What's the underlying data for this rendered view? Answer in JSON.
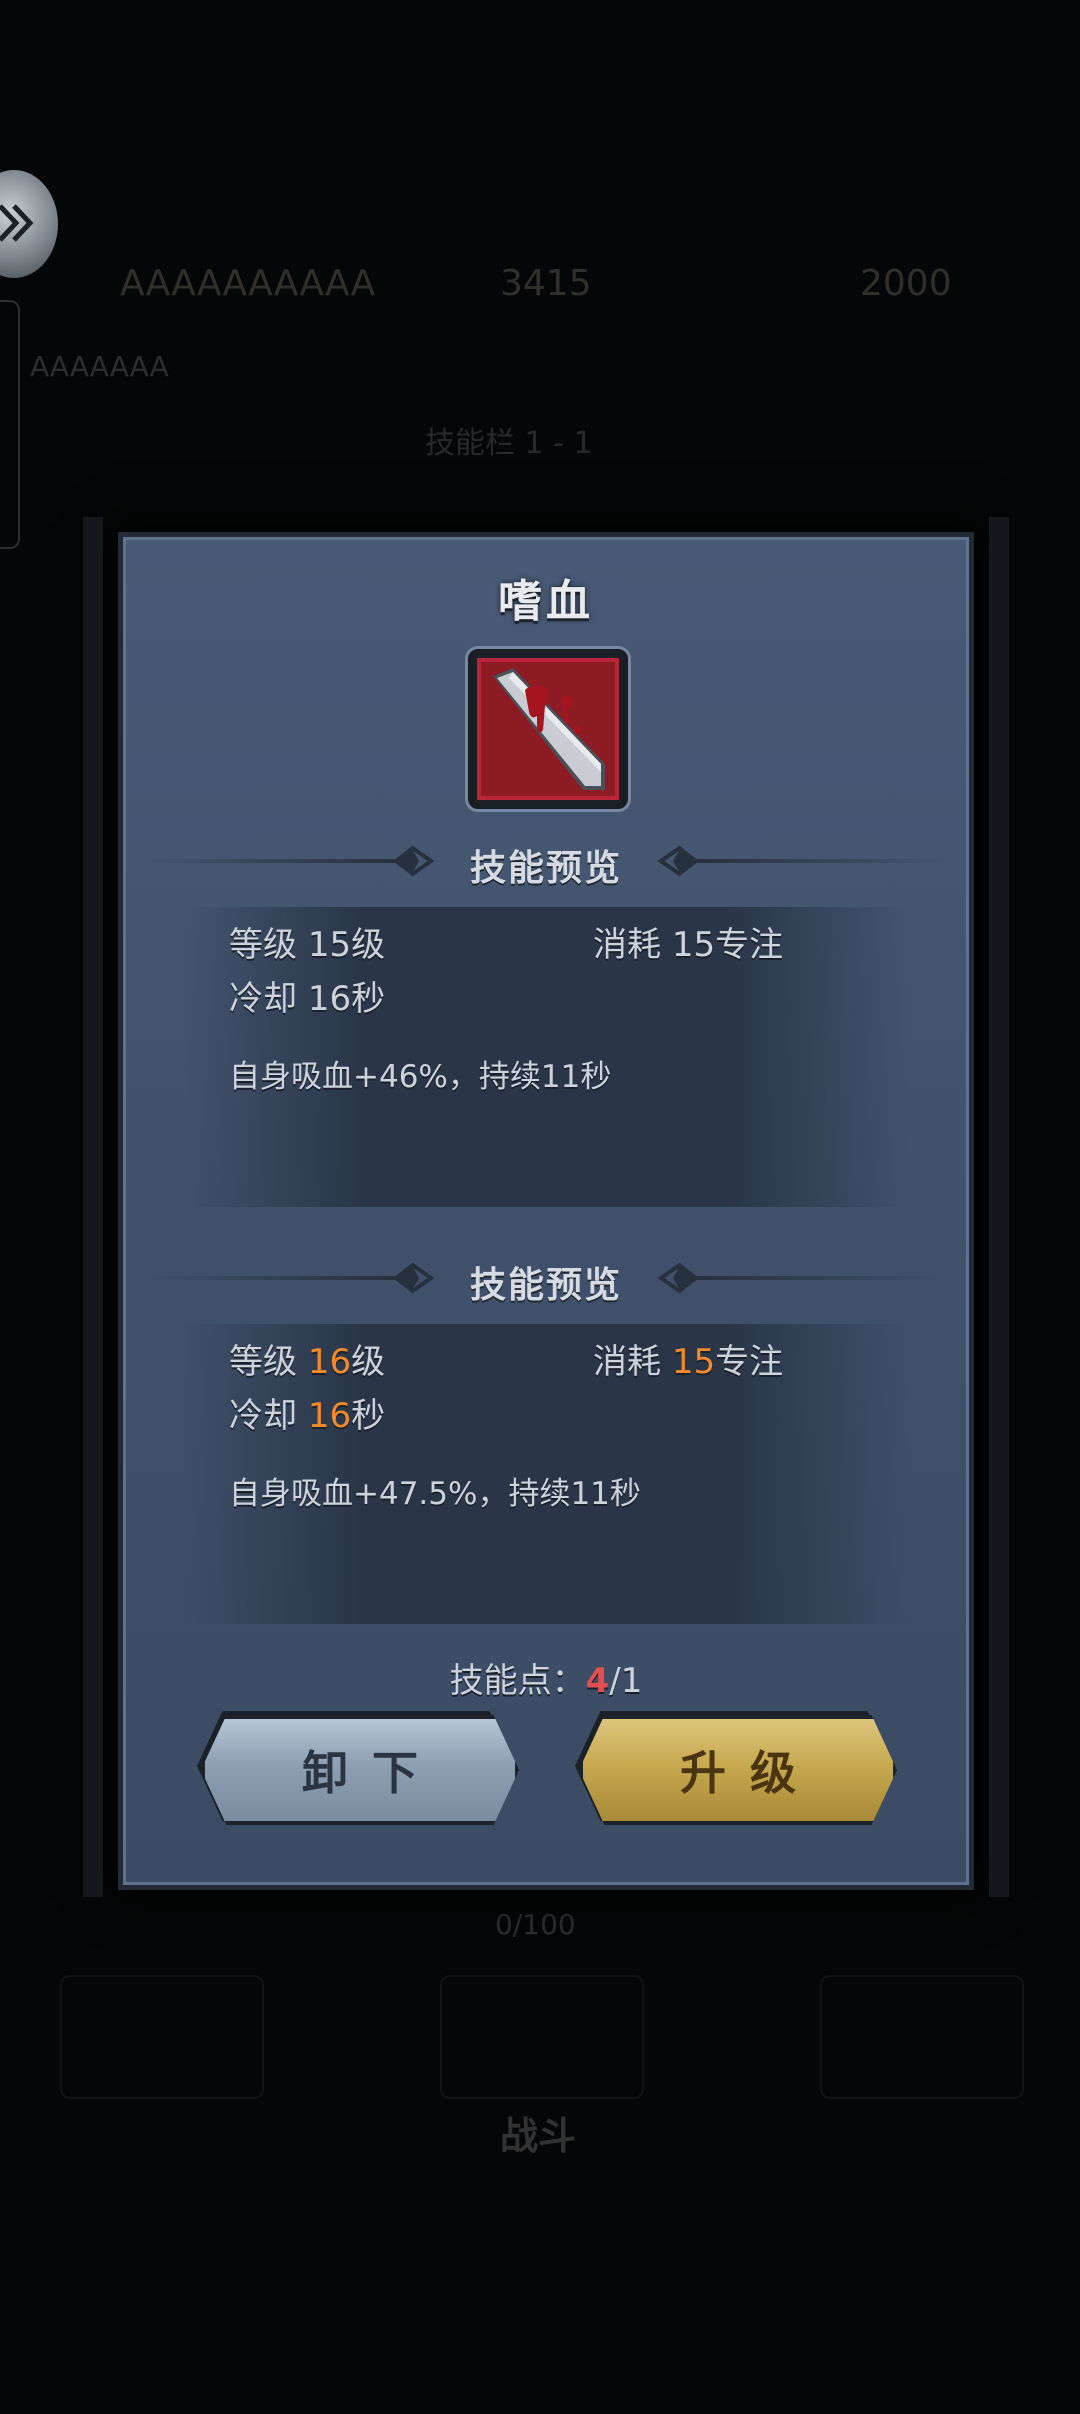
{
  "background": {
    "top_bar_texts": [
      "AAAAAAAAAA",
      "3415",
      "2000"
    ],
    "sub_text": "AAAAAAA",
    "tab_text": "技能栏 1 - 1",
    "progress_text": "0/100",
    "bottom_label": "战斗"
  },
  "dialog": {
    "title": "嗜血",
    "icon": "bloody-blade-icon",
    "current": {
      "header": "技能预览",
      "level_label": "等级",
      "level_value": "15",
      "level_unit": "级",
      "cost_label": "消耗",
      "cost_value": "15",
      "cost_unit": "专注",
      "cooldown_label": "冷却",
      "cooldown_value": "16",
      "cooldown_unit": "秒",
      "effect": "自身吸血+46%，持续11秒"
    },
    "next": {
      "header": "技能预览",
      "level_label": "等级",
      "level_value": "16",
      "level_unit": "级",
      "cost_label": "消耗",
      "cost_value": "15",
      "cost_unit": "专注",
      "cooldown_label": "冷却",
      "cooldown_value": "16",
      "cooldown_unit": "秒",
      "effect": "自身吸血+47.5%，持续11秒"
    },
    "skill_points_label": "技能点：",
    "skill_points_current": "4",
    "skill_points_total": "/1",
    "unload_label": "卸下",
    "upgrade_label": "升级"
  },
  "colors": {
    "highlight": "#f28a2c",
    "points_red": "#e05050",
    "panel": "#445670"
  }
}
